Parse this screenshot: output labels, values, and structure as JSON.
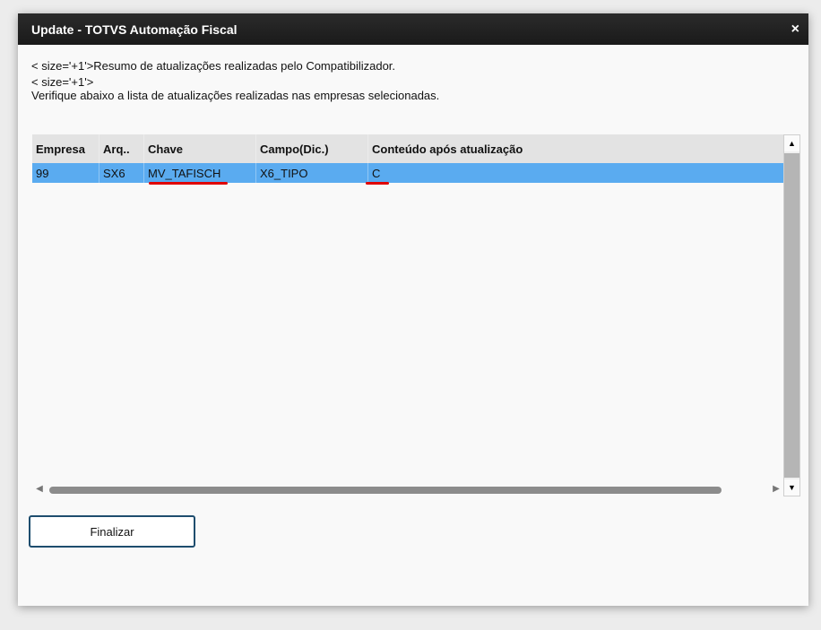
{
  "window": {
    "title": "Update - TOTVS Automação Fiscal",
    "close_label": "×"
  },
  "messages": {
    "line1": "< size='+1'>Resumo de atualizações realizadas pelo Compatibilizador.",
    "line2": "< size='+1'>",
    "line3": "Verifique abaixo a lista de atualizações realizadas nas empresas selecionadas."
  },
  "table": {
    "columns": [
      "Empresa",
      "Arq..",
      "Chave",
      "Campo(Dic.)",
      "Conteúdo após atualização"
    ],
    "rows": [
      [
        "99",
        "SX6",
        "MV_TAFISCH",
        "X6_TIPO",
        "C"
      ]
    ],
    "selected_row_color": "#5aabf0",
    "header_color": "#e3e3e3"
  },
  "scrollbars": {
    "up_icon": "▲",
    "down_icon": "▼",
    "left_icon": "◀",
    "right_icon": "▶"
  },
  "annotations": {
    "underline_color": "#e00000"
  },
  "buttons": {
    "finalizar_label": "Finalizar"
  }
}
